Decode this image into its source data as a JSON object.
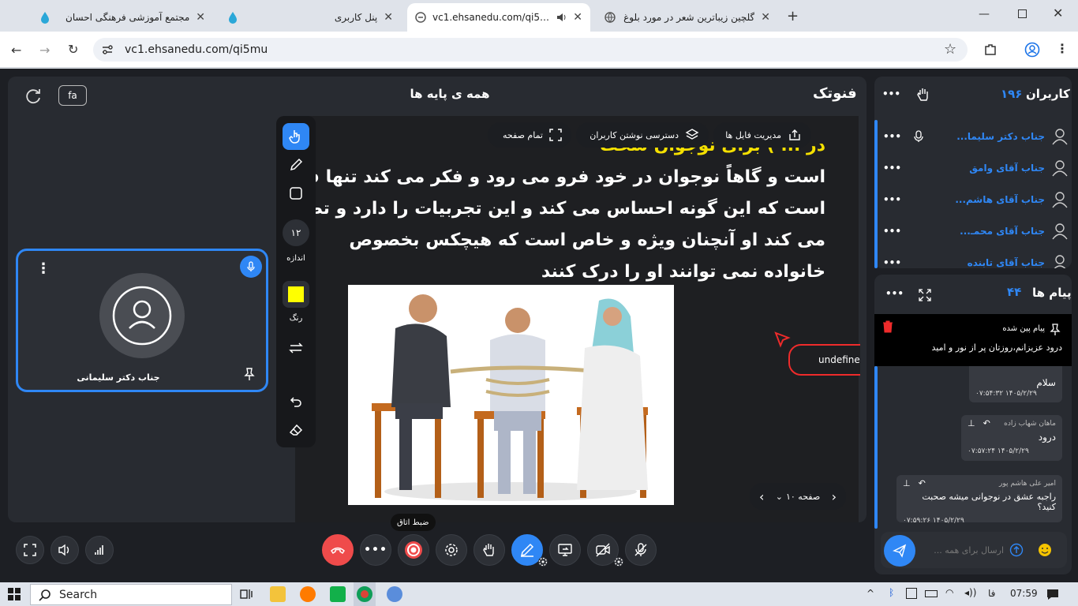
{
  "browser": {
    "tabs": [
      {
        "title": "مجتمع آموزشی فرهنگی احسان",
        "active": false
      },
      {
        "title": "پنل کاربری",
        "active": false
      },
      {
        "title": "vc1.ehsanedu.com/qi5mu",
        "active": true
      },
      {
        "title": "گلچین زیباترین شعر در مورد بلوغ",
        "active": false
      }
    ],
    "url": "vc1.ehsanedu.com/qi5mu"
  },
  "header": {
    "lang_button": "fa",
    "room_title": "همه ی پایه ها",
    "brand": "فنوتک"
  },
  "video_tile": {
    "name": "جناب دکتر سلیمانی"
  },
  "whiteboard": {
    "text_lines": [
      "در ... ) برای نوجوان سخت",
      "است و گاهاً نوجوان در خود فرو می رود و فکر می کند تنها فردی",
      "است که این گونه احساس می کند و این تجربیات را دارد و تصور",
      "می کند او آنچنان ویژه و خاص است که هیچکس بخصوص",
      "خانواده نمی توانند او را درک کنند"
    ],
    "undefined_label": "undefined",
    "page_label": "صفحه ۱۰",
    "pills": {
      "files": "مدیریت فایل ها",
      "write_access": "دسترسی نوشتن کاربران",
      "fullscreen": "تمام صفحه"
    },
    "tools": {
      "size_value": "۱۲",
      "size_label": "اندازه",
      "color_label": "رنگ",
      "color_value": "#ffff00"
    }
  },
  "controls": {
    "record_tooltip": "ضبط اتاق"
  },
  "users_panel": {
    "title": "کاربران",
    "count": "۱۹۶",
    "users": [
      {
        "name": "جناب دکتر سلیما..."
      },
      {
        "name": "جناب آقای وامق"
      },
      {
        "name": "جناب آقای هاشم..."
      },
      {
        "name": "جناب آقای محمـ..."
      },
      {
        "name": "جناب آقای تابنده"
      }
    ]
  },
  "messages_panel": {
    "title": "پیام ها",
    "count": "۴۴",
    "pinned_label": "پیام پین شده",
    "pinned_text": "درود عزیزانم،روزتان پر از نور و امید",
    "messages": [
      {
        "sender": "",
        "text": "سلام",
        "time": "۰۷:۵۴:۳۲ ۱۴۰۵/۲/۲۹"
      },
      {
        "sender": "ماهان شهاب زاده",
        "text": "درود",
        "time": "۰۷:۵۷:۲۴ ۱۴۰۵/۲/۲۹"
      },
      {
        "sender": "امیر علی هاشم پور",
        "text": "راجبه عشق در نوجوانی میشه صحبت کنید؟",
        "time": "۰۷:۵۹:۲۶ ۱۴۰۵/۲/۲۹"
      }
    ],
    "input_placeholder": "ارسال برای همه ..."
  },
  "taskbar": {
    "search_label": "Search",
    "lang": "فا",
    "time": "07:59"
  },
  "colors": {
    "accent_blue": "#2f87f5",
    "danger_red": "#ef4b4b",
    "app_bg": "#1d1f24",
    "panel_bg": "#282b31",
    "highlight_yellow": "#f5e000"
  },
  "icons": [
    "refresh-icon",
    "hand-icon",
    "more-icon",
    "mic-icon",
    "user-icon",
    "expand-icon",
    "pin-icon",
    "trash-icon",
    "reply-icon",
    "send-icon",
    "emoji-icon",
    "upload-icon",
    "pointer-icon",
    "pencil-icon",
    "square-icon",
    "swap-icon",
    "undo-icon",
    "eraser-icon",
    "fullscreen-icon",
    "speaker-icon",
    "signal-icon",
    "hangup-icon",
    "record-icon",
    "gear-icon",
    "whiteboard-icon",
    "share-screen-icon",
    "camera-off-icon",
    "mic-off-icon"
  ]
}
